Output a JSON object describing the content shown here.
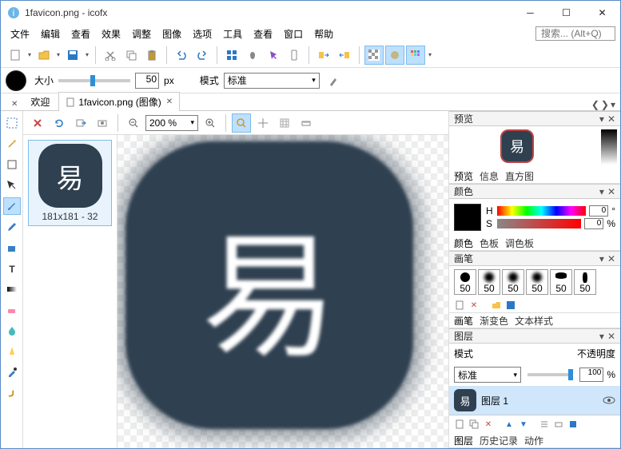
{
  "title": "1favicon.png - icofx",
  "win": {
    "min": "─",
    "max": "☐",
    "close": "✕"
  },
  "menus": [
    "文件",
    "编辑",
    "查看",
    "效果",
    "调整",
    "图像",
    "选项",
    "工具",
    "查看",
    "窗口",
    "帮助"
  ],
  "search_placeholder": "搜索... (Alt+Q)",
  "tool2": {
    "size_label": "大小",
    "size_value": "50",
    "size_unit": "px",
    "mode_label": "模式",
    "mode_value": "标准"
  },
  "tabs": {
    "close": "✕",
    "welcome": "欢迎",
    "doc": "1favicon.png (图像)"
  },
  "nav": {
    "prev": "❮",
    "next": "❯",
    "menu": "▾"
  },
  "center_tb": {
    "zoom": "200 %"
  },
  "thumb": {
    "glyph": "易",
    "caption": "181x181 - 32"
  },
  "canvas_glyph": "易",
  "right": {
    "preview": {
      "title": "预览",
      "glyph": "易",
      "tabs": [
        "预览",
        "信息",
        "直方图"
      ]
    },
    "color": {
      "title": "颜色",
      "H": "H",
      "S": "S",
      "h_val": "0",
      "s_val": "0",
      "deg": "°",
      "pct": "%",
      "tabs": [
        "颜色",
        "色板",
        "调色板"
      ]
    },
    "brush": {
      "title": "画笔",
      "sizes": [
        "50",
        "50",
        "50",
        "50",
        "50",
        "50"
      ],
      "tabs": [
        "画笔",
        "渐变色",
        "文本样式"
      ]
    },
    "layer": {
      "title": "图层",
      "mode_label": "模式",
      "opacity_label": "不透明度",
      "mode_value": "标准",
      "opacity_value": "100",
      "pct": "%",
      "layer1_glyph": "易",
      "layer1_name": "图层 1",
      "tabs": [
        "图层",
        "历史记录",
        "动作"
      ]
    }
  }
}
